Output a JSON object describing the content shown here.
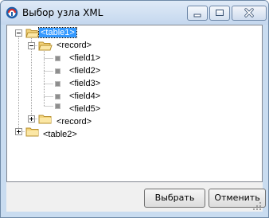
{
  "window": {
    "title": "Выбор узла XML"
  },
  "tree": {
    "nodes": [
      {
        "label": "<table1>",
        "selected": true
      },
      {
        "label": "<record>"
      },
      {
        "label": "<field1>"
      },
      {
        "label": "<field2>"
      },
      {
        "label": "<field3>"
      },
      {
        "label": "<field4>"
      },
      {
        "label": "<field5>"
      },
      {
        "label": "<record>"
      },
      {
        "label": "<table2>"
      }
    ]
  },
  "buttons": {
    "ok_label": "Выбрать",
    "cancel_label": "Отменить"
  },
  "icons": {
    "app": "app-logo-icon",
    "minimize": "minimize-icon",
    "maximize": "maximize-icon",
    "close": "close-icon",
    "folder": "folder-icon",
    "folder_open": "folder-open-icon",
    "field": "field-node-icon"
  },
  "colors": {
    "selection": "#3399ff",
    "close_x": "#ffffff"
  }
}
